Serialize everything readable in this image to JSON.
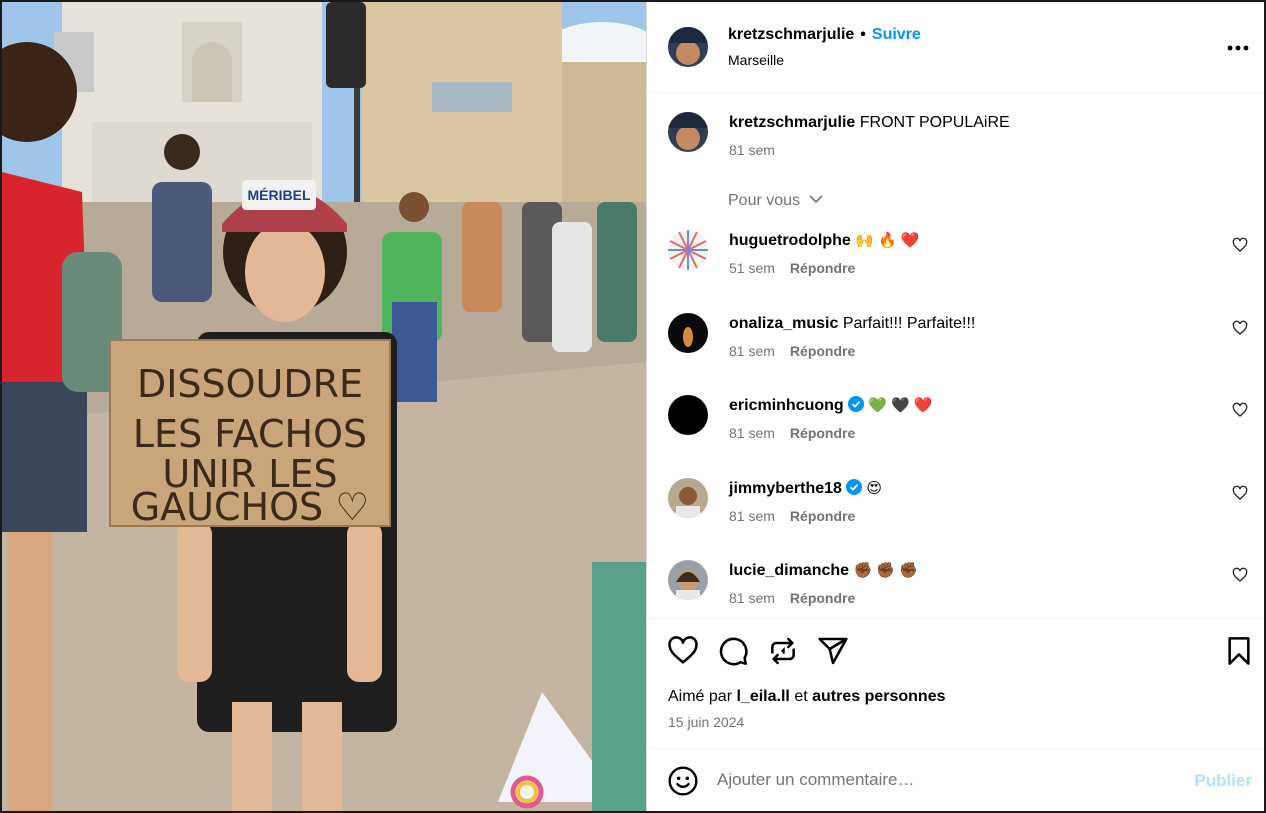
{
  "post": {
    "username": "kretzschmarjulie",
    "dot": "•",
    "follow_label": "Suivre",
    "location": "Marseille",
    "more_icon": "more-horizontal-icon"
  },
  "photo": {
    "sign_lines": [
      "DISSOUDRE",
      "LES FACHOS",
      "UNIR LES",
      "GAUCHOS ♡"
    ],
    "cap_text": "MÉRIBEL"
  },
  "caption": {
    "username": "kretzschmarjulie",
    "text": "FRONT POPULAiRE",
    "time": "81 sem"
  },
  "for_you_label": "Pour vous",
  "comments": [
    {
      "username": "huguetrodolphe",
      "text": "🙌 🔥 ❤️",
      "time": "51 sem",
      "reply": "Répondre",
      "verified": false
    },
    {
      "username": "onaliza_music",
      "text": "Parfait!!! Parfaite!!!",
      "time": "81 sem",
      "reply": "Répondre",
      "verified": false
    },
    {
      "username": "ericminhcuong",
      "text": "💚 🖤 ❤️",
      "time": "81 sem",
      "reply": "Répondre",
      "verified": true
    },
    {
      "username": "jimmyberthe18",
      "text": "😍",
      "time": "81 sem",
      "reply": "Répondre",
      "verified": true
    },
    {
      "username": "lucie_dimanche",
      "text": "✊🏾 ✊🏾 ✊🏾",
      "time": "81 sem",
      "reply": "Répondre",
      "verified": false
    }
  ],
  "likes": {
    "prefix": "Aimé par",
    "user": "l_eila.ll",
    "mid": "et",
    "others": "autres personnes"
  },
  "date": "15 juin 2024",
  "add_comment": {
    "placeholder": "Ajouter un commentaire…",
    "publish": "Publier"
  },
  "colors": {
    "accent": "#0095f6",
    "publish_disabled": "#b2dffc",
    "secondary_text": "#737373"
  }
}
